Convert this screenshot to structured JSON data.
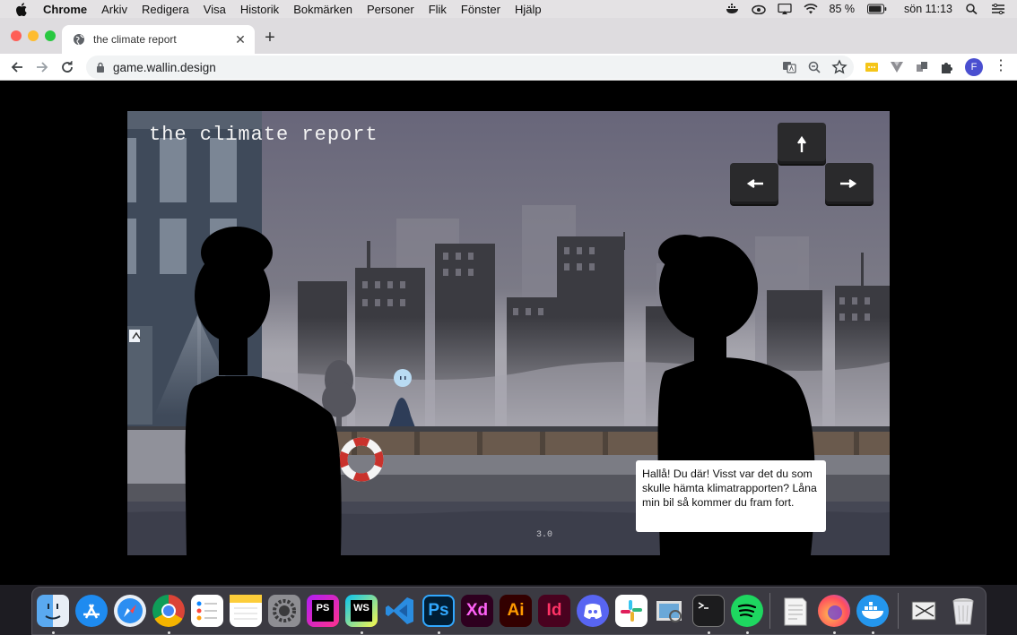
{
  "menubar": {
    "app": "Chrome",
    "items": [
      "Arkiv",
      "Redigera",
      "Visa",
      "Historik",
      "Bokmärken",
      "Personer",
      "Flik",
      "Fönster",
      "Hjälp"
    ],
    "battery": "85 %",
    "clock": "sön 11:13"
  },
  "browser": {
    "tab_title": "the climate report",
    "url": "game.wallin.design",
    "profile_initial": "F"
  },
  "game": {
    "title": "the climate report",
    "version": "3.0",
    "dialog": "Hallå! Du där! Visst var det du som skulle hämta klimatrapporten? Låna min bil så kommer du fram fort.",
    "controls": [
      "arrow-up",
      "arrow-left",
      "arrow-right"
    ]
  },
  "dock": {
    "apps": [
      "Finder",
      "App Store",
      "Safari",
      "Chrome",
      "Reminders",
      "Notes",
      "System Preferences",
      "PhpStorm",
      "WebStorm",
      "Visual Studio Code",
      "Photoshop",
      "Adobe XD",
      "Illustrator",
      "InDesign",
      "Discord",
      "Slack",
      "Preview",
      "Terminal",
      "Spotify",
      "TextEdit",
      "Firefox",
      "Docker",
      "Screenshot",
      "Trash"
    ],
    "labels": {
      "ps_storm": "PS",
      "ws_storm": "WS",
      "photoshop": "Ps",
      "xd": "Xd",
      "illustrator": "Ai",
      "indesign": "Id"
    }
  },
  "colors": {
    "sky": "#6f6d79",
    "buildings_far": "#3a3a40",
    "buildings_near": "#2a2a2e",
    "water": "#4a4a55",
    "silhouette": "#000000",
    "life_ring": "#c9322c"
  }
}
